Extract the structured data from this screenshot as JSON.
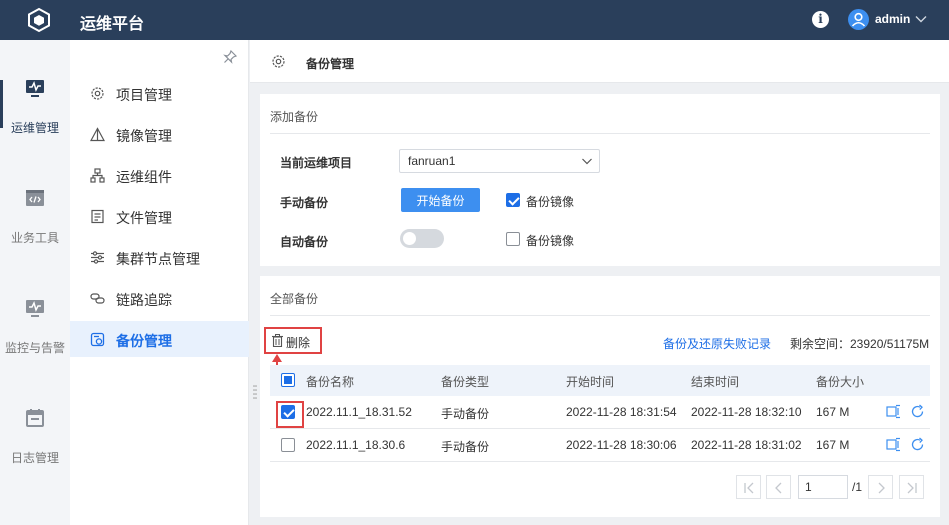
{
  "app": {
    "title": "运维平台",
    "username": "admin"
  },
  "leftnav": [
    {
      "label": "运维管理",
      "icon": "monitor-icon",
      "active": true
    },
    {
      "label": "业务工具",
      "icon": "code-window-icon",
      "active": false
    },
    {
      "label": "监控与告警",
      "icon": "monitor-alert-icon",
      "active": false
    },
    {
      "label": "日志管理",
      "icon": "calendar-icon",
      "active": false
    }
  ],
  "submenu": [
    {
      "label": "项目管理",
      "icon": "gear-icon"
    },
    {
      "label": "镜像管理",
      "icon": "triangle-icon"
    },
    {
      "label": "运维组件",
      "icon": "hierarchy-icon"
    },
    {
      "label": "文件管理",
      "icon": "document-icon"
    },
    {
      "label": "集群节点管理",
      "icon": "sliders-icon"
    },
    {
      "label": "链路追踪",
      "icon": "link-icon"
    },
    {
      "label": "备份管理",
      "icon": "backup-icon",
      "active": true
    }
  ],
  "breadcrumb": {
    "title": "备份管理"
  },
  "add_backup": {
    "title": "添加备份",
    "project_label": "当前运维项目",
    "project_value": "fanruan1",
    "manual_label": "手动备份",
    "start_button": "开始备份",
    "manual_image_label": "备份镜像",
    "manual_image_checked": true,
    "auto_label": "自动备份",
    "auto_enabled": false,
    "auto_image_label": "备份镜像",
    "auto_image_checked": false
  },
  "all_backups": {
    "title": "全部备份",
    "delete_label": "删除",
    "failure_link": "备份及还原失败记录",
    "space_info": "剩余空间：23920/51175M",
    "columns": [
      "备份名称",
      "备份类型",
      "开始时间",
      "结束时间",
      "备份大小"
    ],
    "rows": [
      {
        "name": "2022.11.1_18.31.52",
        "type": "手动备份",
        "start": "2022-11-28 18:31:54",
        "end": "2022-11-28 18:32:10",
        "size": "167 M",
        "checked": true
      },
      {
        "name": "2022.11.1_18.30.6",
        "type": "手动备份",
        "start": "2022-11-28 18:30:06",
        "end": "2022-11-28 18:31:02",
        "size": "167 M",
        "checked": false
      }
    ],
    "pagination": {
      "page": "1",
      "total": "/1"
    }
  },
  "colors": {
    "topbar": "#2a3f5b",
    "accent": "#1d6ee6",
    "button": "#3d8ff0",
    "highlight": "#e04343"
  }
}
